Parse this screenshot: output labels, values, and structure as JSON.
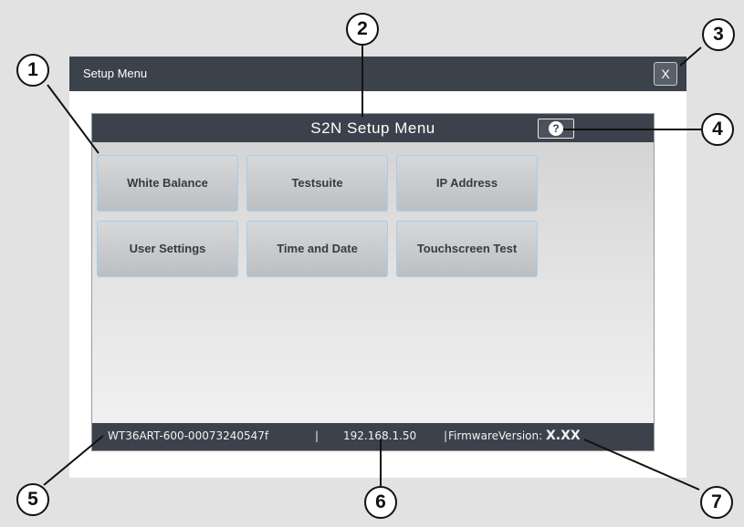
{
  "window": {
    "title": "Setup Menu",
    "close_label": "X"
  },
  "panel": {
    "title": "S2N Setup Menu",
    "help_label": "?"
  },
  "menu": {
    "buttons": [
      {
        "label": "White Balance"
      },
      {
        "label": "Testsuite"
      },
      {
        "label": "IP Address"
      },
      {
        "label": "User Settings"
      },
      {
        "label": "Time and Date"
      },
      {
        "label": "Touchscreen Test"
      }
    ]
  },
  "status": {
    "serial": "WT36ART-600-00073240547f",
    "separator": "|",
    "ip": "192.168.1.50",
    "firmware_separator": "|",
    "firmware_label": "FirmwareVersion:",
    "firmware_value": "X.XX"
  },
  "callouts": [
    "1",
    "2",
    "3",
    "4",
    "5",
    "6",
    "7"
  ],
  "colors": {
    "background": "#e2e2e2",
    "bar": "#3c424b",
    "button_border": "#a9cde6"
  },
  "icons": {
    "close": "close-icon",
    "help": "help-icon"
  }
}
